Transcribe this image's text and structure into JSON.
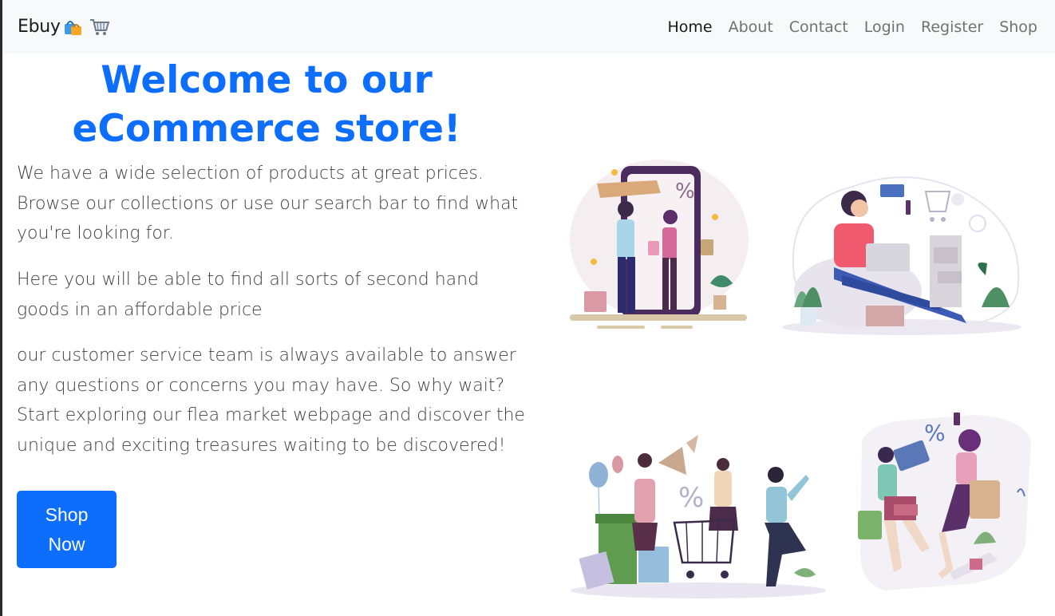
{
  "navbar": {
    "brand": "Ebuy",
    "brand_icons": [
      "shopping-bags-icon",
      "shopping-cart-icon"
    ],
    "links": [
      {
        "label": "Home",
        "active": true
      },
      {
        "label": "About",
        "active": false
      },
      {
        "label": "Contact",
        "active": false
      },
      {
        "label": "Login",
        "active": false
      },
      {
        "label": "Register",
        "active": false
      },
      {
        "label": "Shop",
        "active": false
      }
    ]
  },
  "hero": {
    "title_line1": "Welcome to our",
    "title_line2": "eCommerce store!",
    "paragraphs": [
      "We have a wide selection of products at great prices. Browse our collections or use our search bar to find what you're looking for.",
      "Here you will be able to find all sorts of second hand goods in an affordable price",
      "our customer service team is always available to answer any questions or concerns you may have. So why wait? Start exploring our flea market webpage and discover the unique and exciting treasures waiting to be discovered!"
    ],
    "cta_line1": "Shop",
    "cta_line2": "Now"
  },
  "illustrations": [
    {
      "icon": "phone-shopping-illustration",
      "badge": "%"
    },
    {
      "icon": "online-shopping-laptop-illustration"
    },
    {
      "icon": "shopping-crowd-illustration",
      "badge": "%"
    },
    {
      "icon": "shopping-sale-illustration",
      "badge": "%"
    }
  ],
  "colors": {
    "accent": "#0d6efd",
    "navbar_bg": "#f8f9fa",
    "text": "#3f3f3f"
  }
}
